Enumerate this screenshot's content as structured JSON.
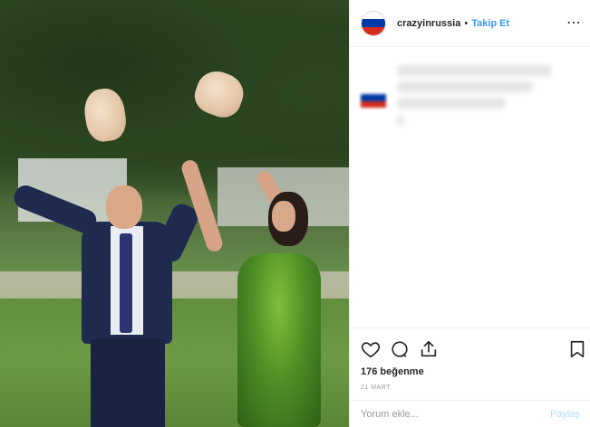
{
  "header": {
    "username": "crazyinrussia",
    "separator": "•",
    "follow_label": "Takip Et",
    "more_icon": "⋯"
  },
  "flag_colors": [
    "#ffffff",
    "#0039a6",
    "#d52b1e"
  ],
  "actions": {
    "icons": [
      "heart-icon",
      "comment-icon",
      "share-icon",
      "bookmark-icon"
    ],
    "likes_text": "176 beğenme",
    "date_text": "21 MART"
  },
  "comment_box": {
    "placeholder": "Yorum ekle...",
    "submit_label": "Paylaş"
  },
  "colors": {
    "accent": "#3897f0",
    "text": "#262626",
    "muted": "#999999",
    "border": "#efefef",
    "share_disabled": "#b3dbff"
  }
}
